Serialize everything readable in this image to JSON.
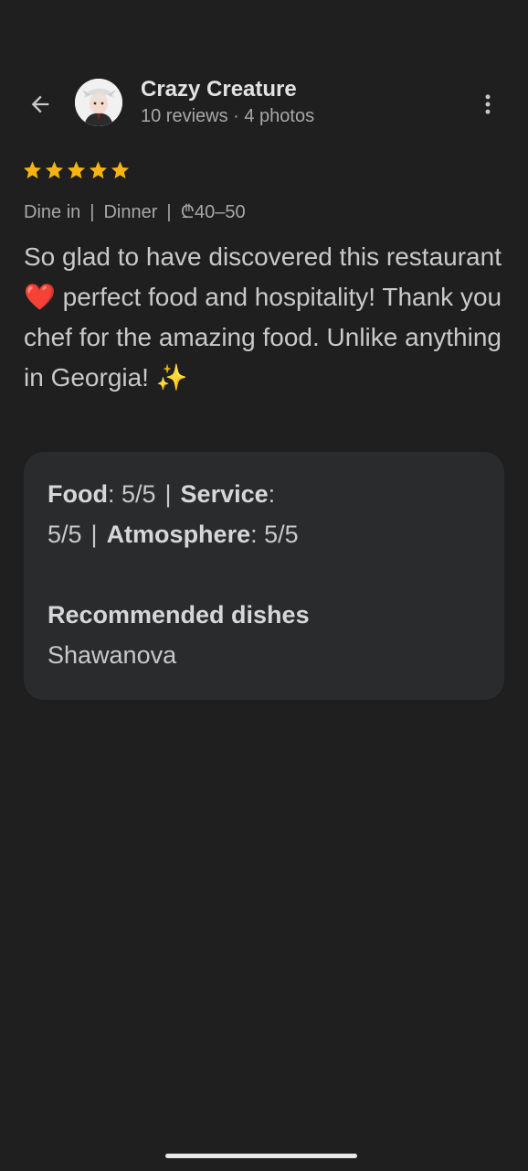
{
  "header": {
    "back_icon": "arrow-left-icon",
    "avatar_icon": "user-avatar",
    "name": "Crazy Creature",
    "meta": "10 reviews · 4 photos",
    "more_icon": "more-vertical-icon"
  },
  "rating": {
    "stars": 5,
    "max": 5,
    "color": "#f6b40e"
  },
  "tags": {
    "mode": "Dine in",
    "meal": "Dinner",
    "price": "₾40–50"
  },
  "review": {
    "text": "So glad to have discovered this restaurant ❤️ perfect food and hospitality! Thank you chef for the amazing food. Unlike anything in Georgia! ✨"
  },
  "card": {
    "food_label": "Food",
    "food_value": ": 5/5",
    "service_label": "Service",
    "service_value": ": 5/5",
    "atmosphere_label": "Atmosphere",
    "atmosphere_value": ": 5/5",
    "separator": "|",
    "recommended_title": "Recommended dishes",
    "recommended_dish": "Shawanova"
  },
  "colors": {
    "background": "#1f1f1f",
    "card": "#2a2b2d",
    "star": "#f6b40e"
  }
}
